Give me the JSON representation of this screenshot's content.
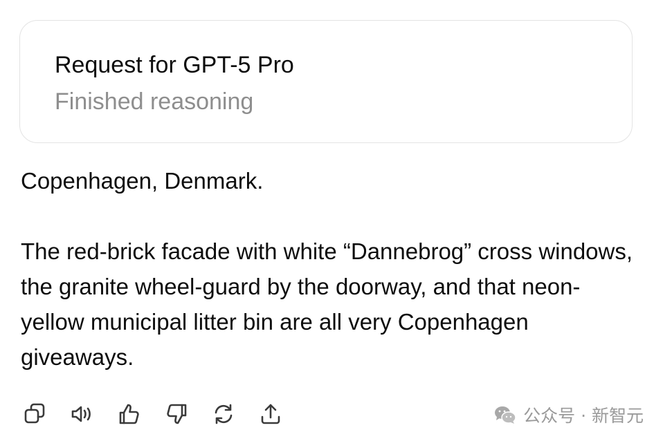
{
  "request_card": {
    "title": "Request for GPT-5 Pro",
    "status": "Finished reasoning"
  },
  "answer": {
    "paragraphs": [
      "Copenhagen, Denmark.",
      "The red-brick facade with white “Dannebrog” cross windows, the granite wheel-guard by the doorway, and that neon-yellow municipal litter bin are all very Copenhagen giveaways."
    ]
  },
  "actions": [
    {
      "icon": "copy-icon"
    },
    {
      "icon": "read-aloud-icon"
    },
    {
      "icon": "thumbs-up-icon"
    },
    {
      "icon": "thumbs-down-icon"
    },
    {
      "icon": "regenerate-icon"
    },
    {
      "icon": "share-icon"
    }
  ],
  "watermark": {
    "icon": "wechat-icon",
    "text": "公众号 · 新智元"
  },
  "colors": {
    "text": "#0d0d0d",
    "muted": "#8e8e8e",
    "card_border": "#e3e3e3",
    "icon": "#3a3a3a",
    "watermark": "#9a9a9a"
  }
}
